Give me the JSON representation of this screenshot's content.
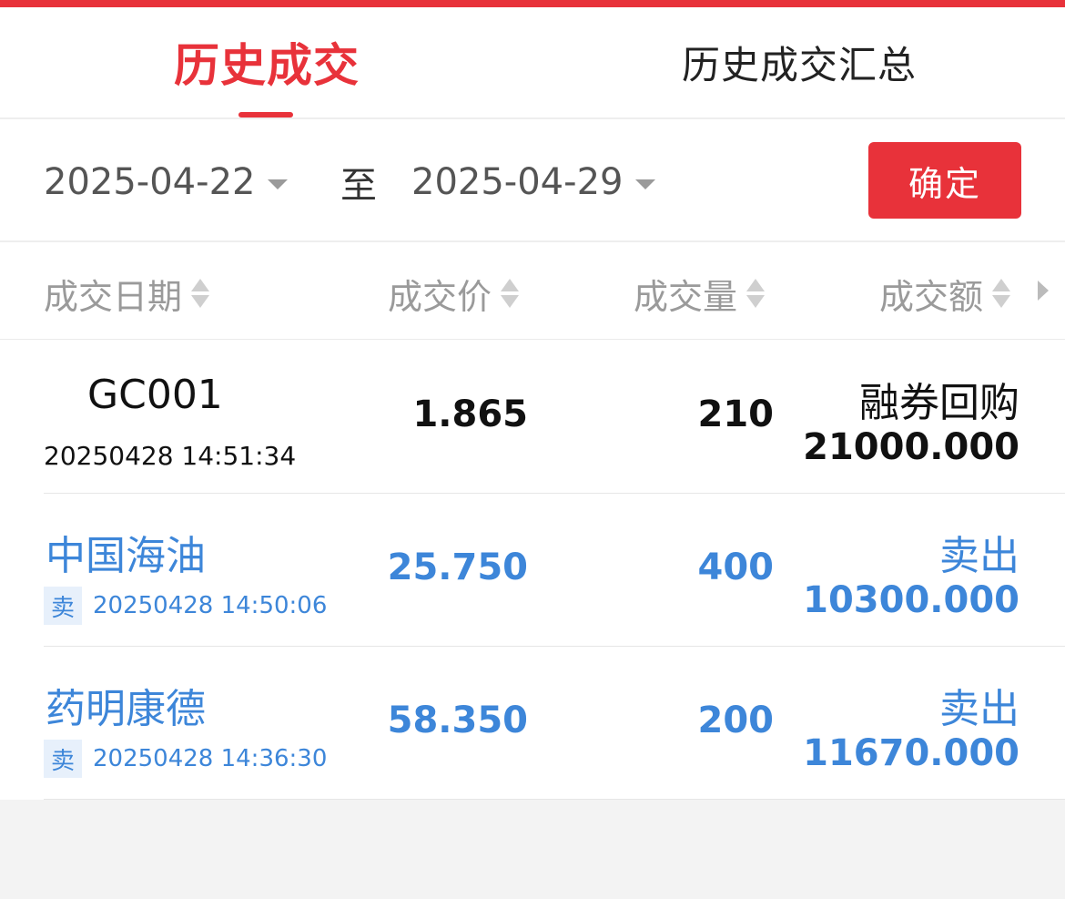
{
  "tabs": [
    {
      "label": "历史成交",
      "active": true
    },
    {
      "label": "历史成交汇总",
      "active": false
    }
  ],
  "date_range": {
    "start": "2025-04-22",
    "separator": "至",
    "end": "2025-04-29",
    "confirm_label": "确定"
  },
  "columns": {
    "date": "成交日期",
    "price": "成交价",
    "quantity": "成交量",
    "amount": "成交额"
  },
  "rows": [
    {
      "name": "GC001",
      "side_badge": "",
      "time": "20250428 14:51:34",
      "price": "1.865",
      "quantity": "210",
      "action": "融券回购",
      "amount": "21000.000"
    },
    {
      "name": "中国海油",
      "side_badge": "卖",
      "time": "20250428 14:50:06",
      "price": "25.750",
      "quantity": "400",
      "action": "卖出",
      "amount": "10300.000"
    },
    {
      "name": "药明康德",
      "side_badge": "卖",
      "time": "20250428 14:36:30",
      "price": "58.350",
      "quantity": "200",
      "action": "卖出",
      "amount": "11670.000"
    }
  ],
  "colors": {
    "accent": "#e8323a",
    "sell_blue": "#3d86d9",
    "badge_bg": "#e7f0fb",
    "header_gray": "#9a9a9a"
  },
  "icons": {
    "dropdown": "caret-down-icon",
    "sort": "sort-updown-icon",
    "scroll": "chevron-right-icon"
  }
}
